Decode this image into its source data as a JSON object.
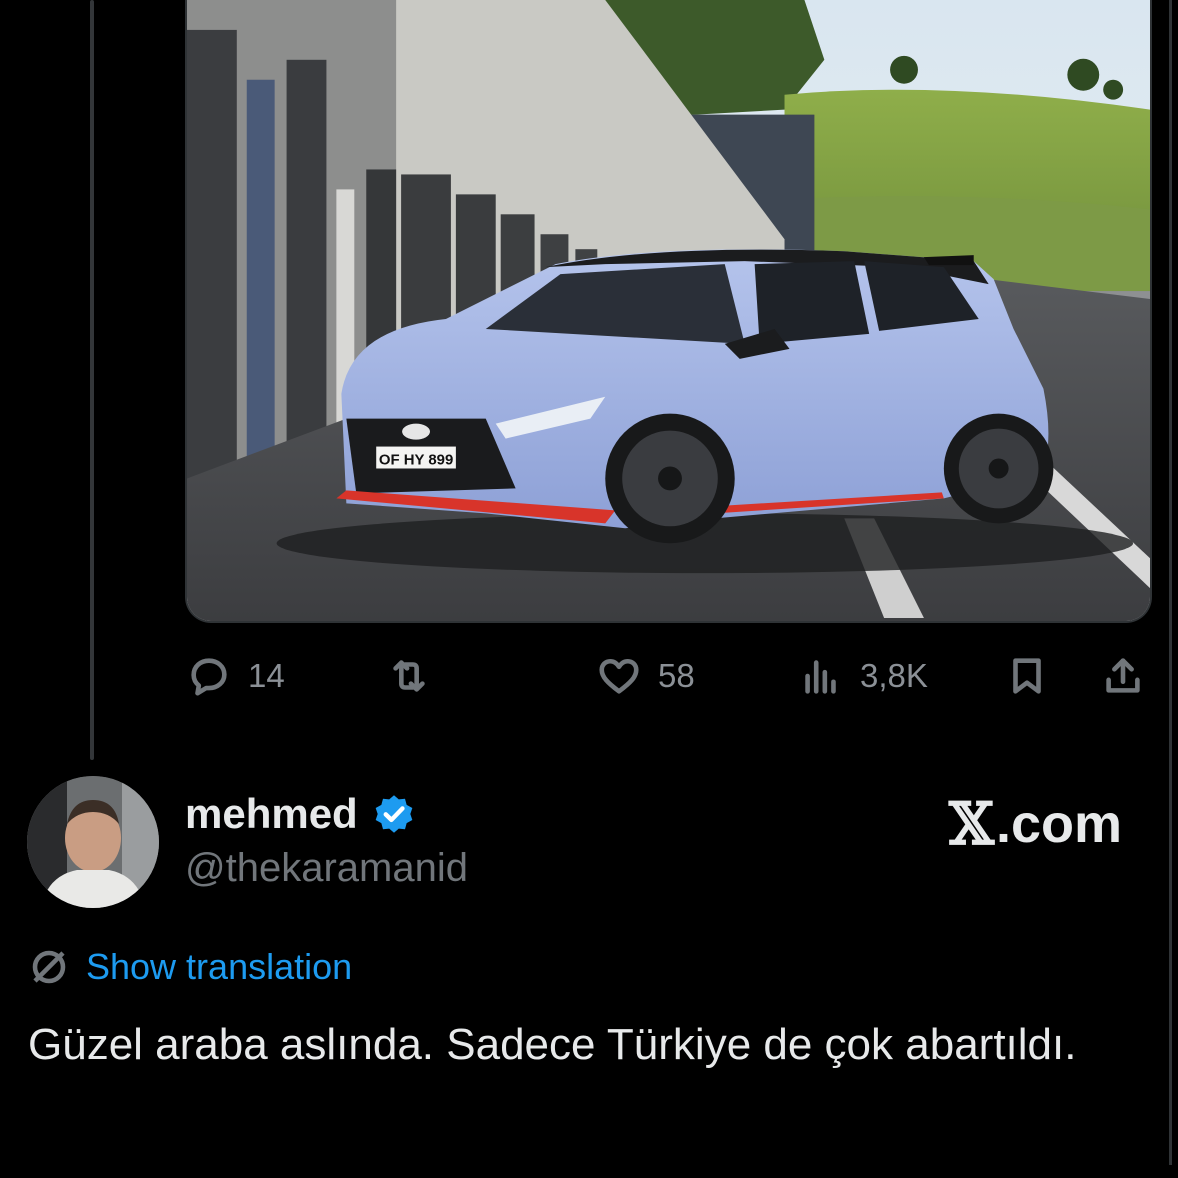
{
  "post": {
    "metrics": {
      "replies": "14",
      "reposts": "",
      "likes": "58",
      "views": "3,8K"
    },
    "image": {
      "plate": "OF HY 899",
      "description_icon": "car-photo"
    }
  },
  "reply": {
    "display_name": "mehmed",
    "handle": "@thekaramanid",
    "verified": true,
    "brand": "X.com",
    "brand_x": "𝕏",
    "brand_rest": ".com",
    "show_translation": "Show translation",
    "text": "Güzel araba aslında. Sadece Türkiye de çok abartıldı."
  },
  "icons": {
    "reply": "speech-bubble-icon",
    "repost": "repost-arrows-icon",
    "like": "heart-icon",
    "views": "bar-chart-icon",
    "bookmark": "bookmark-icon",
    "share": "share-upload-icon",
    "translate": "globe-slash-icon",
    "verified": "verified-badge-icon"
  },
  "colors": {
    "background": "#000000",
    "text": "#e7e9ea",
    "muted": "#71767b",
    "link": "#1d9bf0",
    "verified": "#1d9bf0"
  }
}
